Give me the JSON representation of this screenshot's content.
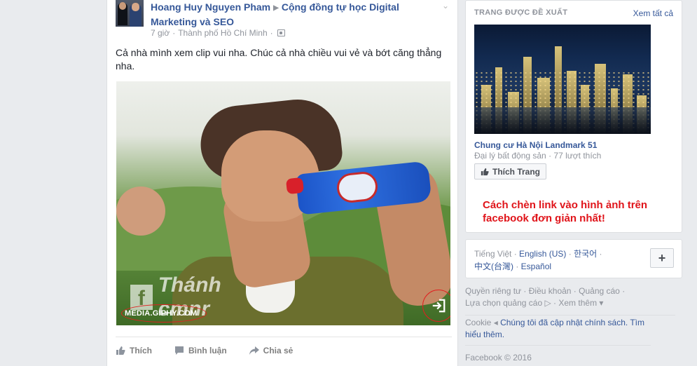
{
  "post": {
    "author": "Hoang Huy Nguyen Pham",
    "arrow": "▶",
    "group": "Cộng đồng tự học Digital Marketing và SEO",
    "time": "7 giờ",
    "dot": "·",
    "location": "Thành phố Hồ Chí Minh",
    "text": "Cả nhà mình xem clip vui nha. Chúc cả nhà chiều vui vẻ và bớt căng thẳng nha.",
    "gif_watermark": "Thánh cmnr",
    "gif_source": "MEDIA.GIPHY.COM",
    "actions": {
      "like": "Thích",
      "comment": "Bình luận",
      "share": "Chia sẻ"
    }
  },
  "suggested": {
    "heading": "TRANG ĐƯỢC ĐỀ XUẤT",
    "see_all": "Xem tất cả",
    "page_name": "Chung cư Hà Nội Landmark 51",
    "page_sub": "Đại lý bất động sản · 77 lượt thích",
    "like_button": "Thích Trang"
  },
  "annotation": "Cách chèn link vào hình ảnh trên facebook đơn giản nhất!",
  "languages": {
    "current": "Tiếng Việt",
    "sep": " · ",
    "english": "English (US)",
    "korean": "한국어",
    "chinese": "中文(台灣)",
    "spanish": "Español",
    "plus": "+"
  },
  "footer": {
    "privacy": "Quyền riêng tư",
    "terms": "Điều khoản",
    "ads": "Quảng cáo",
    "ad_choices": "Lựa chọn quảng cáo",
    "more": "Xem thêm",
    "cookie": "Cookie",
    "cookie_notice": "Chúng tôi đã cập nhật chính sách.",
    "learn_more": "Tìm hiểu thêm.",
    "copyright": "Facebook © 2016"
  },
  "colors": {
    "link": "#365899",
    "muted": "#90949c",
    "annotation_red": "#e0141a"
  }
}
